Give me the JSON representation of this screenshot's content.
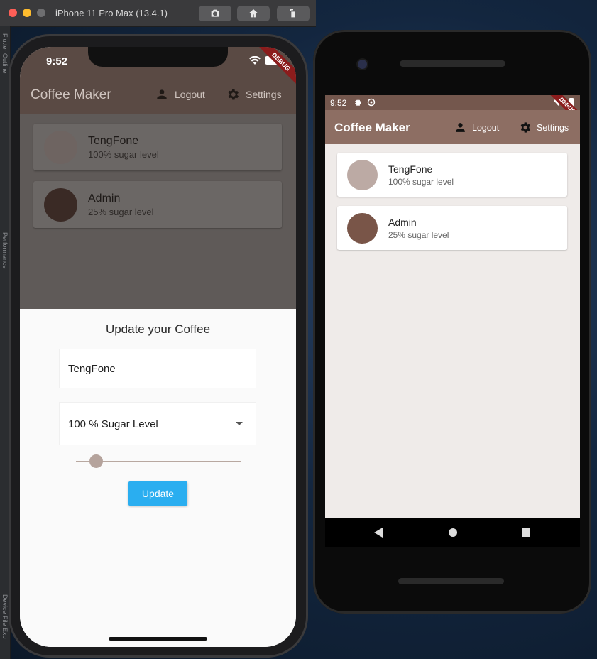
{
  "simulator": {
    "title": "iPhone 11 Pro Max (13.4.1)",
    "buttons": [
      "camera-icon",
      "home-icon",
      "rotate-icon"
    ]
  },
  "ide": {
    "labels": [
      "Flutter Outline",
      "Performance",
      "Device File Exp"
    ]
  },
  "ios": {
    "time": "9:52",
    "debug_banner": "DEBUG",
    "appbar": {
      "title": "Coffee Maker",
      "logout": "Logout",
      "settings": "Settings"
    },
    "cards": [
      {
        "name": "TengFone",
        "sub": "100% sugar level",
        "avatar_color": "#6e6461"
      },
      {
        "name": "Admin",
        "sub": "25% sugar level",
        "avatar_color": "#3a2a25"
      }
    ],
    "sheet": {
      "title": "Update your Coffee",
      "name_value": "TengFone",
      "sugar_select": "100 % Sugar Level",
      "slider_value": 0.1,
      "button": "Update"
    }
  },
  "android": {
    "time": "9:52",
    "debug_banner": "DEBUG",
    "appbar": {
      "title": "Coffee Maker",
      "logout": "Logout",
      "settings": "Settings"
    },
    "cards": [
      {
        "name": "TengFone",
        "sub": "100% sugar level",
        "avatar_color": "#bcaaa4"
      },
      {
        "name": "Admin",
        "sub": "25% sugar level",
        "avatar_color": "#795548"
      }
    ]
  },
  "colors": {
    "ios_appbar": "#5a4a44",
    "android_appbar": "#8d6e63",
    "android_status": "#74574d",
    "update_button": "#2aaef0"
  }
}
